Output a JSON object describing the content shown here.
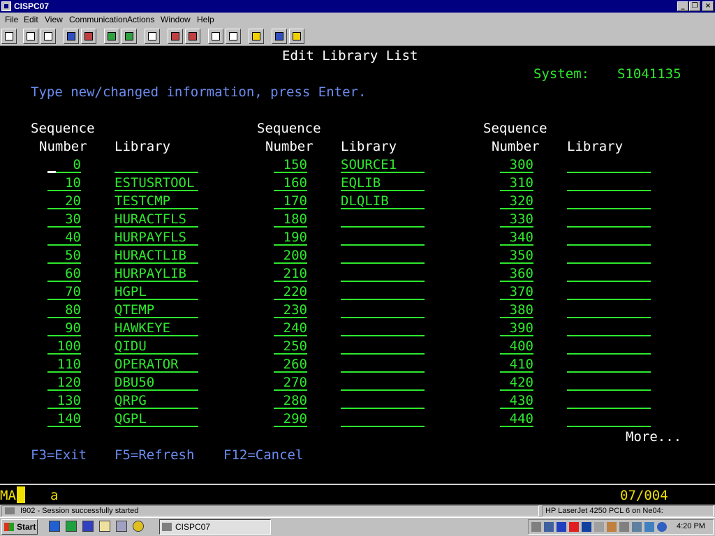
{
  "window": {
    "title": "CISPC07",
    "minimize": "_",
    "restore": "❐",
    "close": "×"
  },
  "menu": [
    "File",
    "Edit",
    "View",
    "Communication",
    "Actions",
    "Window",
    "Help"
  ],
  "screen": {
    "title": "Edit Library List",
    "system_label": "System:",
    "system_value": "S1041135",
    "instruction": "Type new/changed information, press Enter.",
    "hdr_sequence": "Sequence",
    "hdr_number": "Number",
    "hdr_library": "Library",
    "columns": [
      {
        "entries": [
          {
            "seq": "0",
            "lib": ""
          },
          {
            "seq": "10",
            "lib": "ESTUSRTOOL"
          },
          {
            "seq": "20",
            "lib": "TESTCMP"
          },
          {
            "seq": "30",
            "lib": "HURACTFLS"
          },
          {
            "seq": "40",
            "lib": "HURPAYFLS"
          },
          {
            "seq": "50",
            "lib": "HURACTLIB"
          },
          {
            "seq": "60",
            "lib": "HURPAYLIB"
          },
          {
            "seq": "70",
            "lib": "HGPL"
          },
          {
            "seq": "80",
            "lib": "QTEMP"
          },
          {
            "seq": "90",
            "lib": "HAWKEYE"
          },
          {
            "seq": "100",
            "lib": "QIDU"
          },
          {
            "seq": "110",
            "lib": "OPERATOR"
          },
          {
            "seq": "120",
            "lib": "DBU50"
          },
          {
            "seq": "130",
            "lib": "QRPG"
          },
          {
            "seq": "140",
            "lib": "QGPL"
          }
        ]
      },
      {
        "entries": [
          {
            "seq": "150",
            "lib": "SOURCE1"
          },
          {
            "seq": "160",
            "lib": "EQLIB"
          },
          {
            "seq": "170",
            "lib": "DLQLIB"
          },
          {
            "seq": "180",
            "lib": ""
          },
          {
            "seq": "190",
            "lib": ""
          },
          {
            "seq": "200",
            "lib": ""
          },
          {
            "seq": "210",
            "lib": ""
          },
          {
            "seq": "220",
            "lib": ""
          },
          {
            "seq": "230",
            "lib": ""
          },
          {
            "seq": "240",
            "lib": ""
          },
          {
            "seq": "250",
            "lib": ""
          },
          {
            "seq": "260",
            "lib": ""
          },
          {
            "seq": "270",
            "lib": ""
          },
          {
            "seq": "280",
            "lib": ""
          },
          {
            "seq": "290",
            "lib": ""
          }
        ]
      },
      {
        "entries": [
          {
            "seq": "300",
            "lib": ""
          },
          {
            "seq": "310",
            "lib": ""
          },
          {
            "seq": "320",
            "lib": ""
          },
          {
            "seq": "330",
            "lib": ""
          },
          {
            "seq": "340",
            "lib": ""
          },
          {
            "seq": "350",
            "lib": ""
          },
          {
            "seq": "360",
            "lib": ""
          },
          {
            "seq": "370",
            "lib": ""
          },
          {
            "seq": "380",
            "lib": ""
          },
          {
            "seq": "390",
            "lib": ""
          },
          {
            "seq": "400",
            "lib": ""
          },
          {
            "seq": "410",
            "lib": ""
          },
          {
            "seq": "420",
            "lib": ""
          },
          {
            "seq": "430",
            "lib": ""
          },
          {
            "seq": "440",
            "lib": ""
          }
        ]
      }
    ],
    "more": "More...",
    "function_keys": [
      "F3=Exit",
      "F5=Refresh",
      "F12=Cancel"
    ]
  },
  "oia": {
    "indicator": "MA",
    "input_char": "a",
    "cursor_pos": "07/004"
  },
  "statusbar": {
    "message": "I902 - Session successfully started",
    "printer": "HP LaserJet 4250 PCL 6 on Ne04:"
  },
  "taskbar": {
    "start": "Start",
    "task_label": "CISPC07",
    "clock": "4:20 PM"
  },
  "colors": {
    "field_green": "#2ee82e",
    "heading_white": "#ffffff",
    "instruction_blue": "#6c8cf0",
    "oia_yellow": "#f0e000",
    "titlebar_blue": "#000080"
  }
}
